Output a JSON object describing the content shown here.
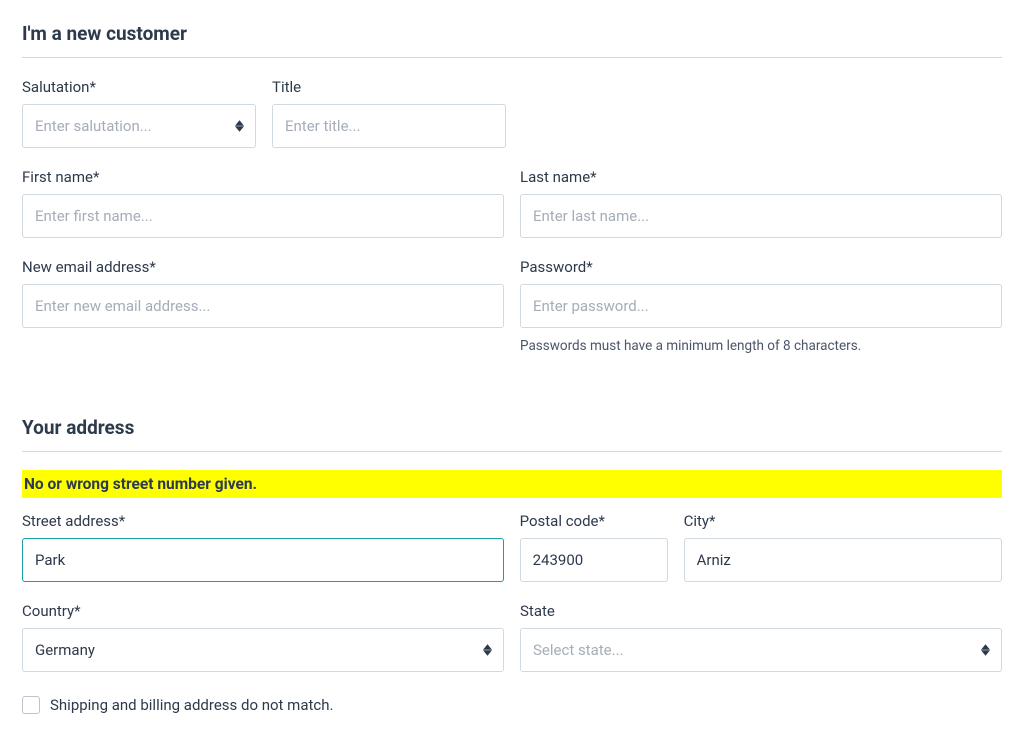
{
  "section1": {
    "title": "I'm a new customer",
    "salutation": {
      "label": "Salutation*",
      "placeholder": "Enter salutation..."
    },
    "title_field": {
      "label": "Title",
      "placeholder": "Enter title..."
    },
    "first_name": {
      "label": "First name*",
      "placeholder": "Enter first name..."
    },
    "last_name": {
      "label": "Last name*",
      "placeholder": "Enter last name..."
    },
    "email": {
      "label": "New email address*",
      "placeholder": "Enter new email address..."
    },
    "password": {
      "label": "Password*",
      "placeholder": "Enter password...",
      "help": "Passwords must have a minimum length of 8 characters."
    }
  },
  "section2": {
    "title": "Your address",
    "alert": "No or wrong street number given.",
    "street": {
      "label": "Street address*",
      "value": "Park"
    },
    "postal": {
      "label": "Postal code*",
      "value": "243900"
    },
    "city": {
      "label": "City*",
      "value": "Arniz"
    },
    "country": {
      "label": "Country*",
      "value": "Germany"
    },
    "state": {
      "label": "State",
      "placeholder": "Select state..."
    },
    "checkbox": {
      "label": "Shipping and billing address do not match."
    }
  }
}
